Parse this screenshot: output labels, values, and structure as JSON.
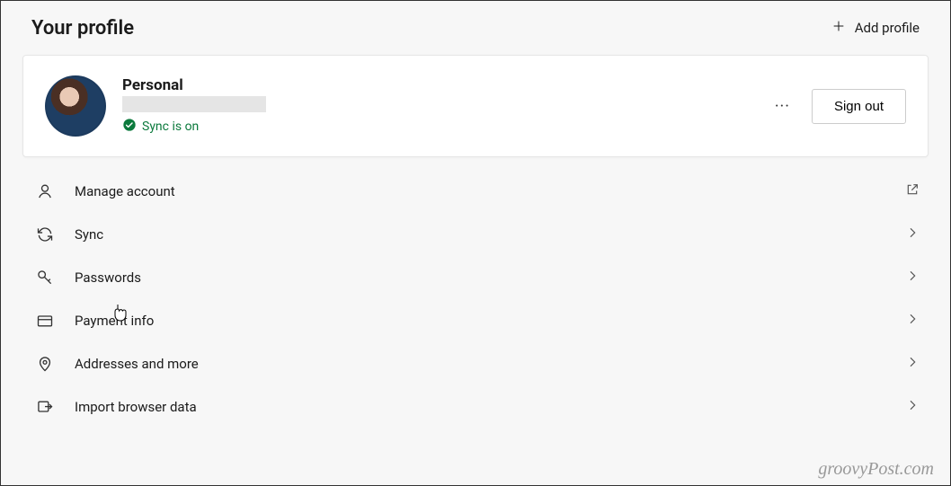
{
  "header": {
    "title": "Your profile",
    "add_profile_label": "Add profile"
  },
  "profile": {
    "name": "Personal",
    "sync_status": "Sync is on",
    "more_label": "···",
    "signout_label": "Sign out"
  },
  "menu": [
    {
      "key": "manage-account",
      "label": "Manage account",
      "tail": "external"
    },
    {
      "key": "sync",
      "label": "Sync",
      "tail": "chevron"
    },
    {
      "key": "passwords",
      "label": "Passwords",
      "tail": "chevron"
    },
    {
      "key": "payment-info",
      "label": "Payment info",
      "tail": "chevron"
    },
    {
      "key": "addresses",
      "label": "Addresses and more",
      "tail": "chevron"
    },
    {
      "key": "import",
      "label": "Import browser data",
      "tail": "chevron"
    }
  ],
  "watermark": "groovyPost.com"
}
